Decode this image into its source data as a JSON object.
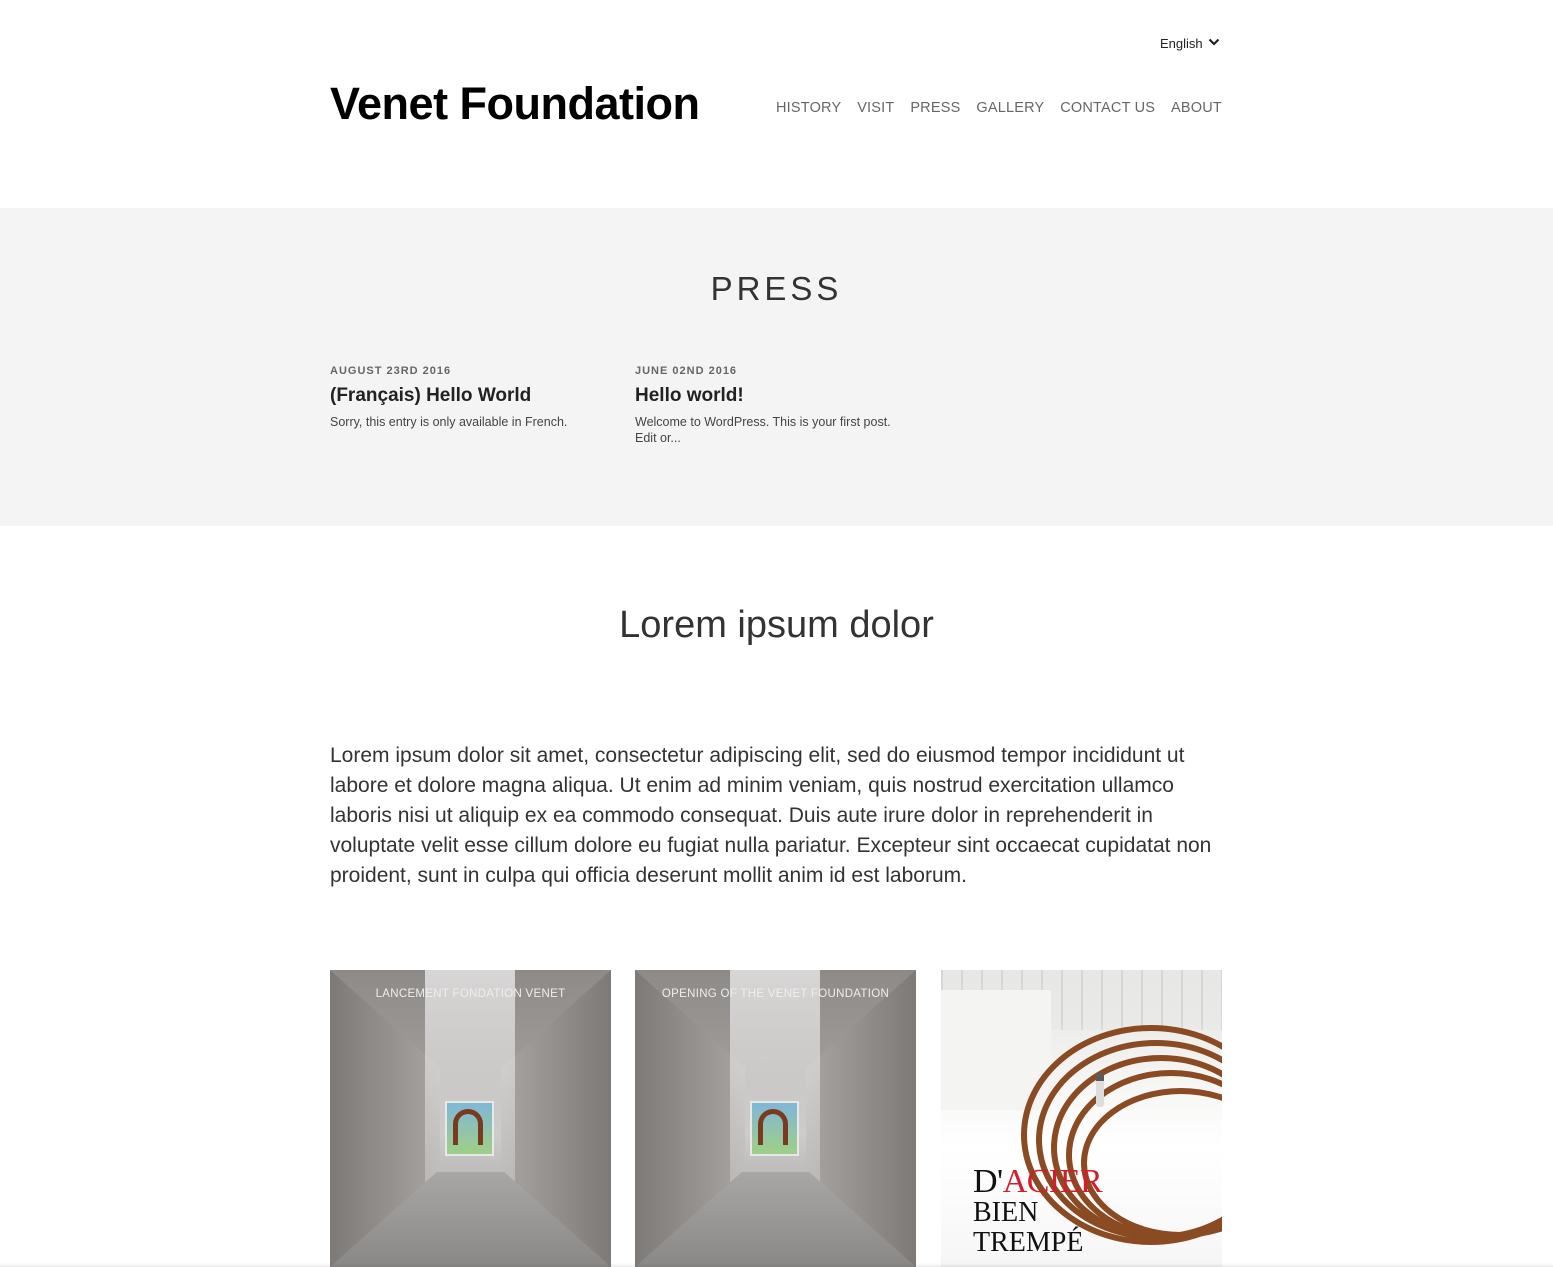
{
  "header": {
    "language": "English",
    "site_title": "Venet Foundation",
    "nav": [
      "HISTORY",
      "VISIT",
      "PRESS",
      "GALLERY",
      "CONTACT US",
      "ABOUT"
    ]
  },
  "press": {
    "heading": "PRESS",
    "posts": [
      {
        "date": "AUGUST 23RD 2016",
        "title": "(Français) Hello World",
        "excerpt": "Sorry, this entry is only available in French."
      },
      {
        "date": "JUNE 02ND 2016",
        "title": "Hello world!",
        "excerpt": "Welcome to WordPress. This is your first post. Edit or..."
      }
    ]
  },
  "main": {
    "title": "Lorem ipsum dolor",
    "body": "Lorem ipsum dolor sit amet, consectetur adipiscing elit, sed do eiusmod tempor incididunt ut labore et dolore magna aliqua. Ut enim ad minim veniam, quis nostrud exercitation ullamco laboris nisi ut aliquip ex ea commodo consequat. Duis aute irure dolor in reprehenderit in voluptate velit esse cillum dolore eu fugiat nulla pariatur. Excepteur sint occaecat cupidatat non proident, sunt in culpa qui officia deserunt mollit anim id est laborum."
  },
  "gallery": [
    {
      "caption": "LANCEMENT FONDATION VENET"
    },
    {
      "caption": "OPENING OF THE VENET FOUNDATION"
    },
    {
      "title_black": "D'",
      "title_red": "ACIER",
      "subtitle_1": "BIEN",
      "subtitle_2": "TREMPÉ"
    }
  ],
  "colors": {
    "press_band_bg": "#f4f4f4",
    "nav_text": "#666666",
    "accent_red": "#d01e2a"
  }
}
